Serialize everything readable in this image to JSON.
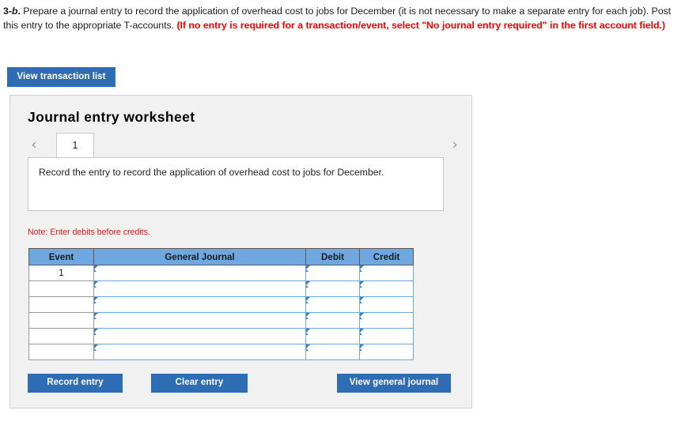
{
  "prompt": {
    "label_prefix": "3-",
    "label_italic": "b",
    "label_suffix": ".",
    "body": " Prepare a journal entry to record the application of overhead cost to jobs for December (it is not necessary to make a separate entry for each job). Post this entry to the appropriate T-accounts. ",
    "red_note": "(If no entry is required for a transaction/event, select \"No journal entry required\" in the first account field.)"
  },
  "toolbar": {
    "view_transaction_list_label": "View transaction list"
  },
  "worksheet": {
    "title": "Journal entry worksheet",
    "prev_icon": "‹",
    "next_icon": "›",
    "tabs": [
      {
        "label": "1",
        "active": true
      }
    ],
    "instruction": "Record the entry to record the application of overhead cost to jobs for December.",
    "note": "Note: Enter debits before credits.",
    "table": {
      "headers": [
        "Event",
        "General Journal",
        "Debit",
        "Credit"
      ],
      "rows": [
        {
          "event": "1",
          "general_journal": "",
          "debit": "",
          "credit": ""
        },
        {
          "event": "",
          "general_journal": "",
          "debit": "",
          "credit": ""
        },
        {
          "event": "",
          "general_journal": "",
          "debit": "",
          "credit": ""
        },
        {
          "event": "",
          "general_journal": "",
          "debit": "",
          "credit": ""
        },
        {
          "event": "",
          "general_journal": "",
          "debit": "",
          "credit": ""
        },
        {
          "event": "",
          "general_journal": "",
          "debit": "",
          "credit": ""
        }
      ]
    },
    "buttons": {
      "record_entry": "Record entry",
      "clear_entry": "Clear entry",
      "view_general_journal": "View general journal"
    }
  },
  "colors": {
    "button_blue": "#2e6db4",
    "table_header_blue": "#6fa8e0",
    "red_text": "#fc0000",
    "note_red": "#e01b1b",
    "panel_bg": "#f1f1f1"
  }
}
